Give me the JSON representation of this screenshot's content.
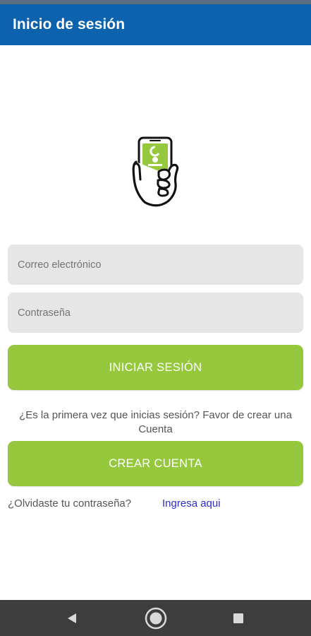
{
  "app_bar": {
    "title": "Inicio de sesión",
    "color": "#0d62ad"
  },
  "logo": {
    "icon": "hand-holding-phone-icon"
  },
  "form": {
    "email_placeholder": "Correo electrónico",
    "password_placeholder": "Contraseña",
    "login_button": "INICIAR SESIÓN",
    "first_time_hint": "¿Es la primera vez que inicias sesión? Favor de crear una Cuenta",
    "create_button": "CREAR CUENTA",
    "forgot_text": "¿Olvidaste tu contraseña?",
    "forgot_link": "Ingresa aqui",
    "button_color": "#95c83d",
    "link_color": "#2b2dc6"
  },
  "nav_bar": {
    "back_icon": "back-triangle-icon",
    "home_icon": "home-circle-icon",
    "recents_icon": "recents-square-icon"
  }
}
